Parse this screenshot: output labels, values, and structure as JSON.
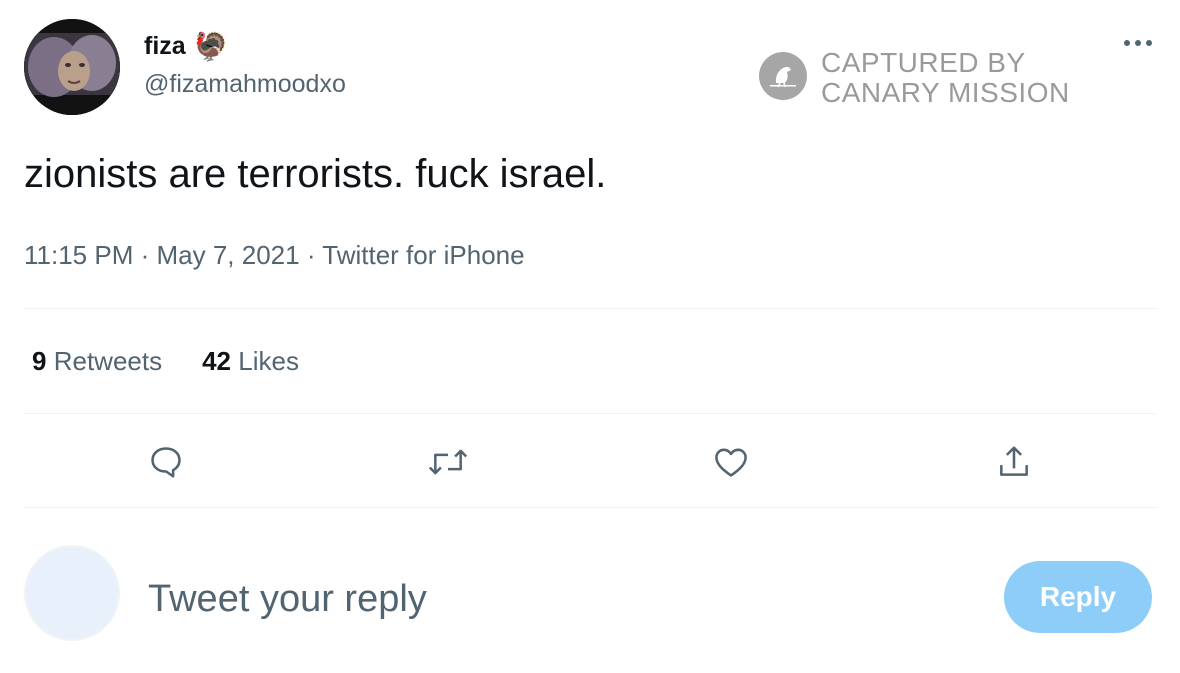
{
  "tweet": {
    "display_name": "fiza",
    "name_emoji": "🦃",
    "handle": "@fizamahmoodxo",
    "text": "zionists are terrorists. fuck israel.",
    "time": "11:15 PM",
    "date": "May 7, 2021",
    "source": "Twitter for iPhone",
    "separator": "·"
  },
  "stats": {
    "retweets_count": "9",
    "retweets_label": "Retweets",
    "likes_count": "42",
    "likes_label": "Likes"
  },
  "watermark": {
    "line1": "CAPTURED BY",
    "line2": "CANARY MISSION"
  },
  "actions": [
    "reply-icon",
    "retweet-icon",
    "like-icon",
    "share-icon"
  ],
  "reply_box": {
    "placeholder": "Tweet your reply",
    "button_label": "Reply"
  },
  "colors": {
    "text_primary": "#0f1419",
    "text_secondary": "#536471",
    "divider": "#eff3f4",
    "reply_button": "#8ecdf8"
  }
}
